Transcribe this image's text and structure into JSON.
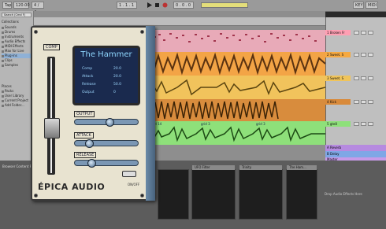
{
  "topbar": {
    "tap": "Tap",
    "tempo": "120.00",
    "signature": "4 / 4",
    "position": "1 . 1 . 1",
    "time": "0 . 0 . 0",
    "key": "KEY",
    "midi": "MIDI"
  },
  "browser": {
    "search_label": "Search (Cmd F)",
    "categories_label": "Collections",
    "items": [
      "Sounds",
      "Drums",
      "Instruments",
      "Audio Effects",
      "MIDI Effects",
      "Max for Live",
      "Plug-ins",
      "Clips",
      "Samples"
    ],
    "places_label": "Places",
    "places": [
      "Packs",
      "User Library",
      "Current Project",
      "Add Folder..."
    ]
  },
  "tracks": [
    {
      "name": "1 Broken Fr",
      "color": "#ff9fb3"
    },
    {
      "name": "2 Sweet. S",
      "color": "#f6a940"
    },
    {
      "name": "3 Sweet. S",
      "color": "#f0c45a"
    },
    {
      "name": "4 Kick",
      "color": "#d98a3a"
    },
    {
      "name": "5 gte8",
      "color": "#8ee07a"
    },
    {
      "name": "A Reverb",
      "color": "#b68ae0"
    },
    {
      "name": "B Delay",
      "color": "#7fa7e6"
    },
    {
      "name": "Master",
      "color": "#c79ae8"
    }
  ],
  "clips": {
    "lane5": [
      "grid 14",
      "grid 3",
      "grid 3"
    ]
  },
  "plugin": {
    "comp_label": "COMP",
    "preset_name": "The Hammer",
    "params": [
      {
        "name": "Comp",
        "value": "20.0"
      },
      {
        "name": "Attack",
        "value": "20.0"
      },
      {
        "name": "Release",
        "value": "50.0"
      },
      {
        "name": "Output",
        "value": "0"
      }
    ],
    "knobs": [
      {
        "label": "OUTPUT",
        "level": 0.55
      },
      {
        "label": "ATTACK",
        "level": 0.18
      },
      {
        "label": "RELEASE",
        "level": 0.22
      }
    ],
    "brand": "ÉPICA AUDIO",
    "power_label": "ON/OFF"
  },
  "devices": {
    "browser_title": "Browser Content Panel",
    "drop_hint": "Drop Audio Effects Here",
    "devs": [
      "UFO Filter",
      "Trinity",
      "The Ham..."
    ]
  },
  "colors": {
    "lcd_bg": "#1a2a4e",
    "lcd_text": "#8fd7ff",
    "plugin_panel": "#e8e3d0",
    "accent_blue": "#7b97b4"
  }
}
